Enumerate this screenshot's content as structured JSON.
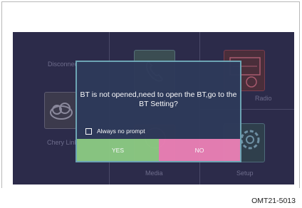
{
  "tiles": {
    "disconnect_label": "Disconnect",
    "chery_label": "Chery Link",
    "media_label": "Media",
    "setup_label": "Setup",
    "radio_label": "Radio"
  },
  "icons": {
    "phone": "phone-icon",
    "radio": "radio-icon",
    "cloud": "cloud-link-icon",
    "media": "media-disc-icon",
    "setup": "gear-icon"
  },
  "dialog": {
    "message": "BT is not opened,need to open the BT,go to the BT Setting?",
    "checkbox_label": "Always no prompt",
    "checkbox_checked": false,
    "yes_label": "YES",
    "no_label": "NO"
  },
  "colors": {
    "screen_bg": "#2c2b4a",
    "dialog_bg": "#2e3a5a",
    "dialog_border": "#6fa8b8",
    "yes_button": "#8ac882",
    "no_button": "#e87fb4"
  },
  "caption": "OMT21-5013"
}
